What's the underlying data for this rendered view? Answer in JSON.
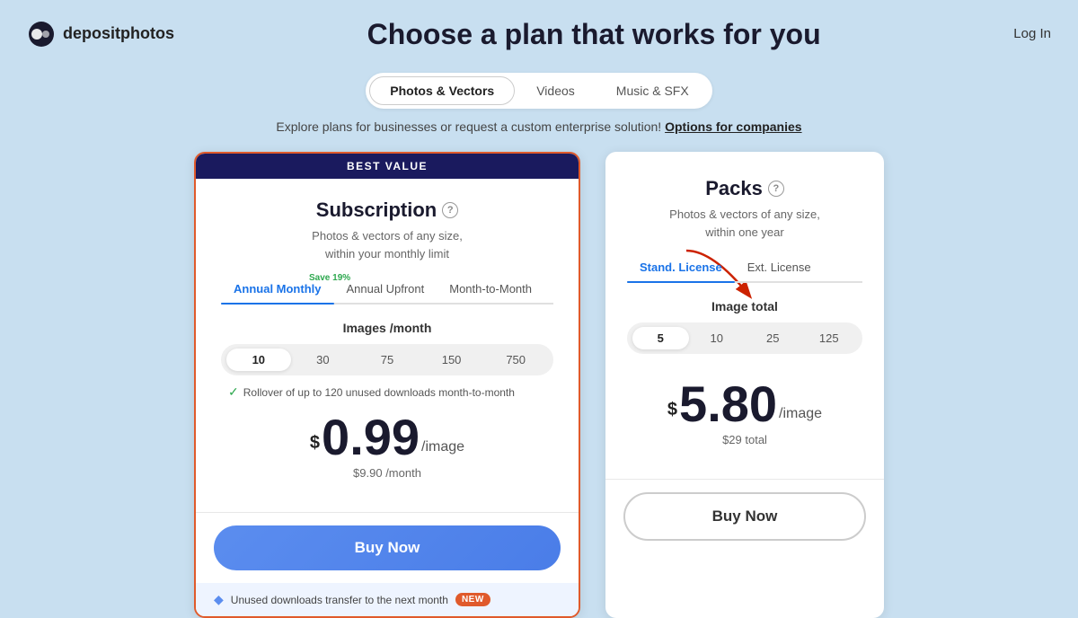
{
  "header": {
    "logo_text": "depositphotos",
    "login_label": "Log In",
    "page_title": "Choose a plan that works for you"
  },
  "tabs": {
    "items": [
      {
        "id": "photos",
        "label": "Photos & Vectors",
        "active": true
      },
      {
        "id": "videos",
        "label": "Videos",
        "active": false
      },
      {
        "id": "music",
        "label": "Music & SFX",
        "active": false
      }
    ]
  },
  "enterprise": {
    "text": "Explore plans for businesses or request a custom enterprise solution!",
    "link_text": "Options for companies"
  },
  "subscription": {
    "best_value_label": "BEST VALUE",
    "title": "Subscription",
    "description": "Photos & vectors of any size,\nwithin your monthly limit",
    "sub_tabs": [
      {
        "id": "annual-monthly",
        "label": "Annual Monthly",
        "active": true
      },
      {
        "id": "annual-upfront",
        "label": "Annual Upfront",
        "active": false
      },
      {
        "id": "month-to-month",
        "label": "Month-to-Month",
        "active": false
      }
    ],
    "save_badge": "Save 19%",
    "images_label": "Images /month",
    "slider_options": [
      "10",
      "30",
      "75",
      "150",
      "750"
    ],
    "slider_active": 0,
    "rollover_text": "Rollover of up to 120 unused downloads month-to-month",
    "price_currency": "$",
    "price_main": "0.99",
    "price_unit": "/image",
    "price_monthly": "$9.90 /month",
    "buy_label": "Buy Now",
    "footer_text": "Unused downloads transfer to the next month",
    "new_badge": "NEW"
  },
  "packs": {
    "title": "Packs",
    "description": "Photos & vectors of any size,\nwithin one year",
    "sub_tabs": [
      {
        "id": "stand-license",
        "label": "Stand. License",
        "active": true
      },
      {
        "id": "ext-license",
        "label": "Ext. License",
        "active": false
      }
    ],
    "image_total_label": "Image total",
    "slider_options": [
      "5",
      "10",
      "25",
      "125"
    ],
    "slider_active": 0,
    "price_currency": "$",
    "price_main": "5.80",
    "price_unit": "/image",
    "price_total": "$29 total",
    "buy_label": "Buy Now"
  },
  "icons": {
    "help": "?",
    "check": "✓",
    "diamond": "◆",
    "logo_circle": "●"
  }
}
